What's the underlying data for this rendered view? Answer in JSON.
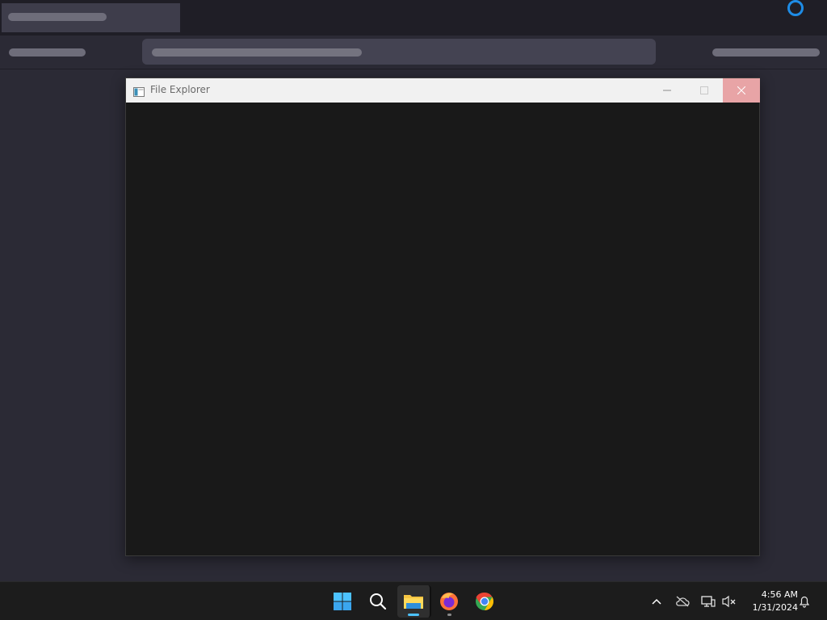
{
  "window": {
    "title": "File Explorer",
    "buttons": {
      "minimize": "—",
      "maximize": "☐",
      "close": "✕"
    }
  },
  "taskbar": {
    "apps": [
      {
        "name": "Start",
        "icon": "windows-start-icon"
      },
      {
        "name": "Search",
        "icon": "search-icon"
      },
      {
        "name": "File Explorer",
        "icon": "folder-icon",
        "active": true
      },
      {
        "name": "Firefox",
        "icon": "firefox-icon"
      },
      {
        "name": "Chrome",
        "icon": "chrome-icon"
      }
    ],
    "tray": {
      "icons": [
        "chevron-up-icon",
        "cloud-offline-icon",
        "network-icon",
        "volume-muted-icon",
        "bell-icon"
      ],
      "time": "4:56 AM",
      "date": "1/31/2024"
    }
  },
  "colors": {
    "desktop_bg": "#2b2a35",
    "titlebar_bg": "#f1f1f1",
    "window_bg": "#191919",
    "close_button": "#e8a4a6",
    "taskbar_bg": "#1c1c1c",
    "accent": "#4cc2ff"
  }
}
